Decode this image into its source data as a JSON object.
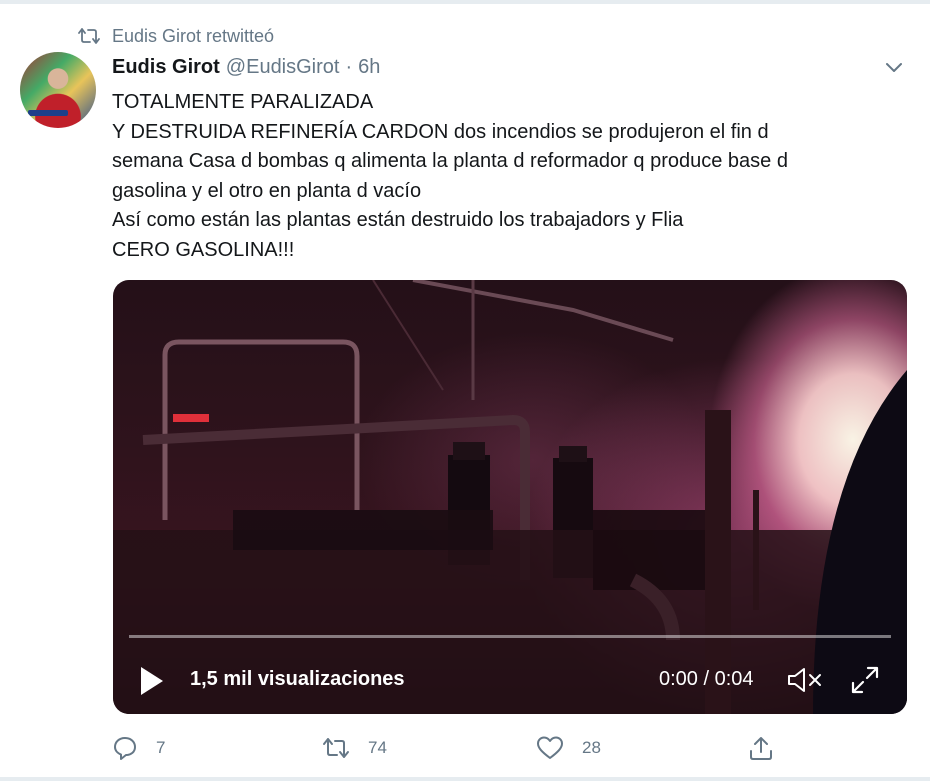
{
  "retweet": {
    "icon": "retweet-icon",
    "label": "Eudis Girot retwitteó"
  },
  "tweet": {
    "author_name": "Eudis Girot",
    "handle": "@EudisGirot",
    "separator": "·",
    "time": "6h",
    "text_lines": [
      "TOTALMENTE PARALIZADA",
      "Y DESTRUIDA REFINERÍA CARDON dos incendios se produjeron el fin d",
      "semana Casa d bombas q alimenta la planta d reformador q produce base d",
      "gasolina y el otro en planta d vacío",
      "Así como están las plantas están destruido los trabajadors y Flia",
      "CERO GASOLINA!!!"
    ]
  },
  "video": {
    "views": "1,5 mil visualizaciones",
    "timecode": "0:00 / 0:04",
    "progress": 0,
    "icons": [
      "play-icon",
      "volume-muted-icon",
      "fullscreen-icon"
    ]
  },
  "actions": {
    "reply_count": "7",
    "retweet_count": "74",
    "like_count": "28"
  },
  "colors": {
    "text": "#14171a",
    "secondary": "#657786",
    "divider": "#e6ecf0"
  }
}
